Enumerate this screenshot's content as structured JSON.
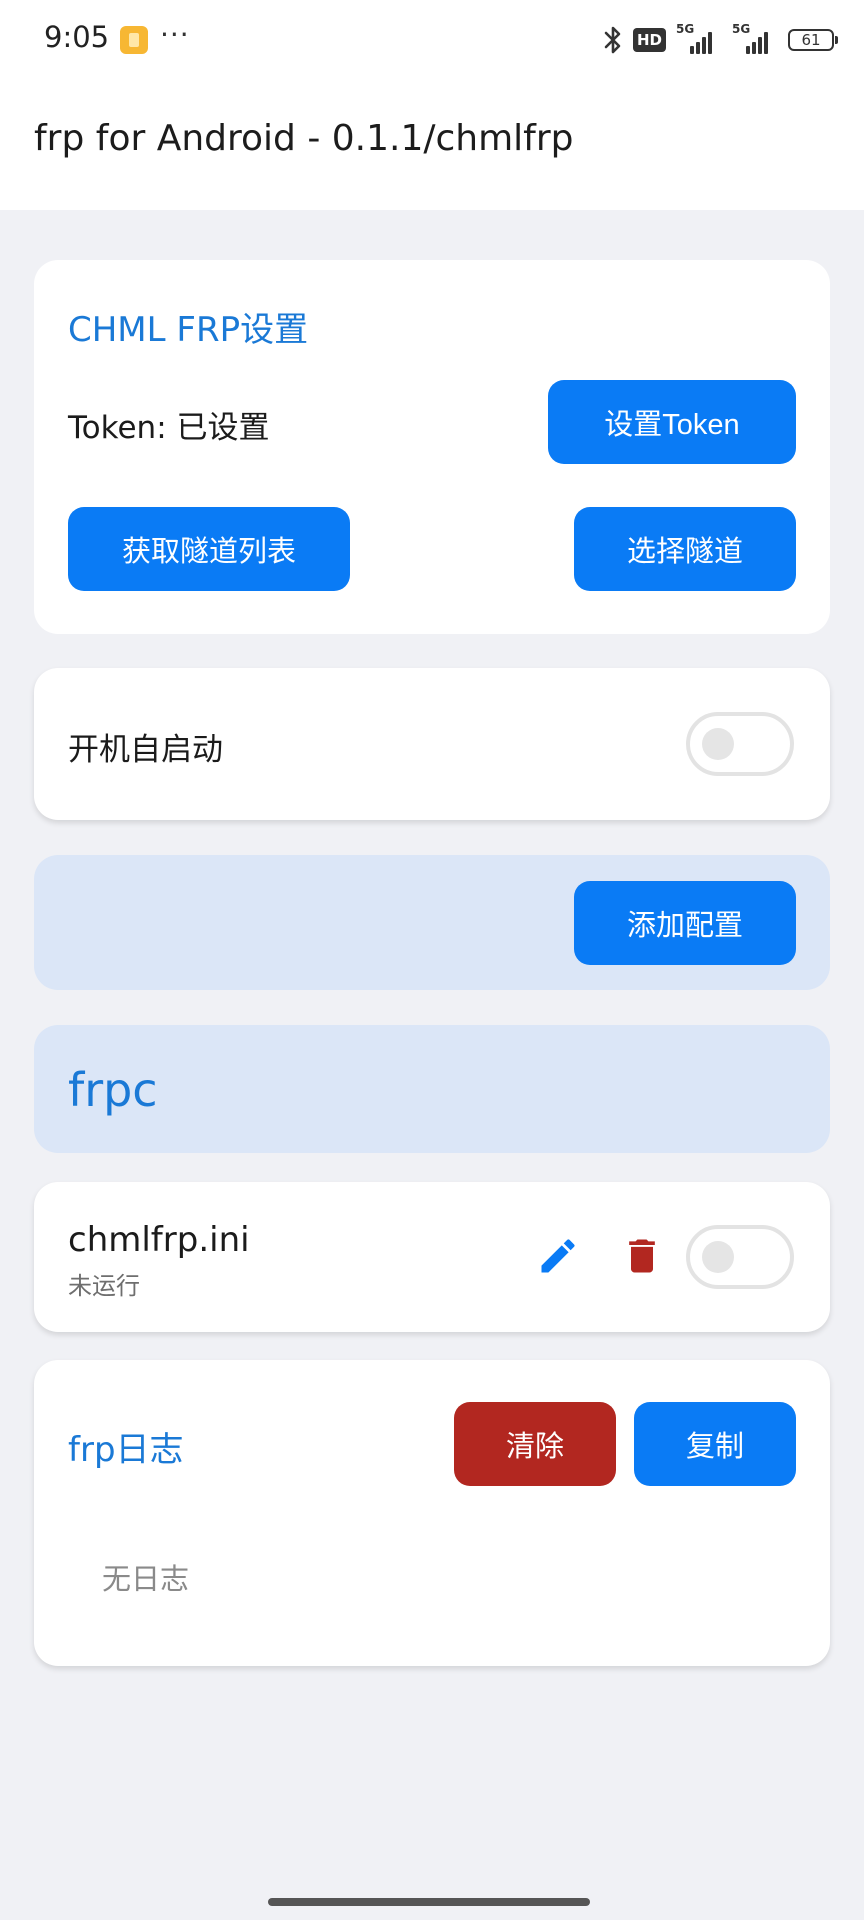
{
  "status_bar": {
    "time": "9:05",
    "more": "···",
    "hd_badge": "HD",
    "signal_1_label": "5G",
    "signal_2_label": "5G",
    "battery": "61"
  },
  "app_bar": {
    "title": "frp for Android - 0.1.1/chmlfrp"
  },
  "chml_settings": {
    "title": "CHML FRP设置",
    "token_status": "Token: 已设置",
    "set_token_button": "设置Token",
    "fetch_tunnels_button": "获取隧道列表",
    "select_tunnel_button": "选择隧道"
  },
  "autostart": {
    "label": "开机自启动",
    "enabled": false
  },
  "add_config": {
    "button": "添加配置"
  },
  "frpc_section": {
    "title": "frpc"
  },
  "config_item": {
    "name": "chmlfrp.ini",
    "status": "未运行",
    "edit_icon": "edit-icon",
    "delete_icon": "delete-icon",
    "running": false
  },
  "log_panel": {
    "title": "frp日志",
    "clear_button": "清除",
    "copy_button": "复制",
    "empty_text": "无日志"
  },
  "colors": {
    "primary": "#0a7bf5",
    "danger": "#b22720",
    "title_blue": "#1a79d6",
    "tinted_card": "#dbe6f7",
    "background": "#f0f1f5"
  }
}
